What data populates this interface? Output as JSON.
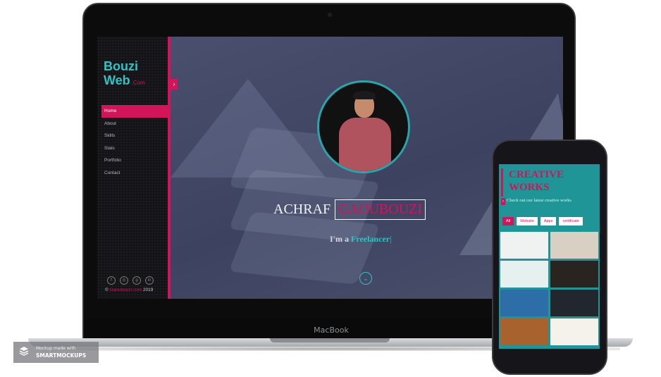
{
  "laptop": {
    "brand_label": "MacBook"
  },
  "site": {
    "brand_line1": "Bouzi",
    "brand_line2": "Web",
    "brand_suffix": ".Com",
    "nav": [
      "Home",
      "About",
      "Skills",
      "Stats",
      "Portfolio",
      "Contact"
    ],
    "active_nav": "Home",
    "social_icons": [
      "facebook-icon",
      "instagram-icon",
      "google-plus-icon",
      "linkedin-icon"
    ],
    "copyright_prefix": "©",
    "copyright_site": "Gaoubouzi.com",
    "copyright_year": "2019",
    "hero_first_name": "ACHRAF",
    "hero_last_name": "GAOUBOUZI",
    "tagline_prefix": "I'm a",
    "tagline_role": "Freelancer",
    "tagline_cursor": "|"
  },
  "phone": {
    "title_line1": "CREATIVE",
    "title_line2": "WORKS",
    "subtitle": "Check out our latest creative works",
    "filters": [
      "All",
      "Website",
      "Apps",
      "certificate"
    ],
    "active_filter": "All",
    "thumbnail_count": 8
  },
  "watermark": {
    "line1": "Mockup made with",
    "line2": "SMARTMOCKUPS"
  },
  "colors": {
    "accent": "#d2145a",
    "teal": "#2ec4c6",
    "hero_bg": "#3f4461",
    "sidebar_bg": "#141418",
    "phone_bg": "#1f9597"
  }
}
